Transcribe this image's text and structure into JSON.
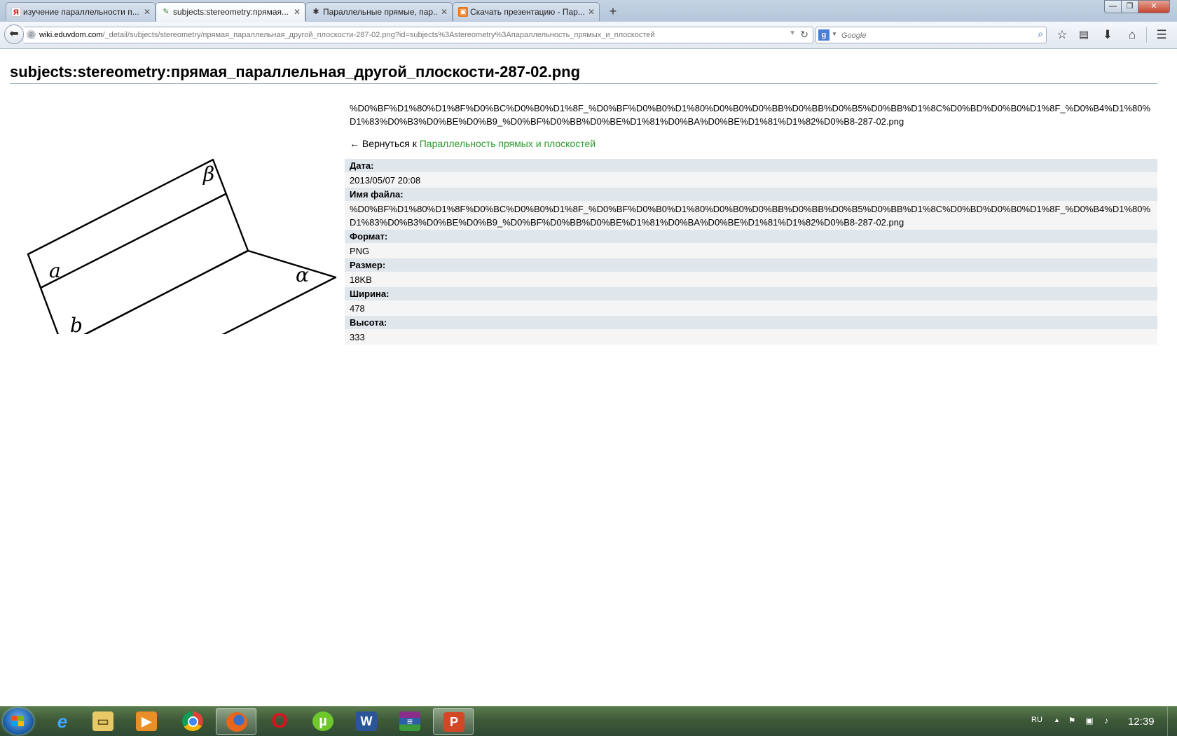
{
  "browser": {
    "tabs": [
      {
        "label": "изучение параллельности п...",
        "icon": "yandex-icon"
      },
      {
        "label": "subjects:stereometry:прямая...",
        "icon": "eduvdom-icon",
        "active": true
      },
      {
        "label": "Параллельные прямые, пар...",
        "icon": "gear-favicon"
      },
      {
        "label": "Скачать презентацию - Пар...",
        "icon": "presentation-icon"
      }
    ],
    "url_host": "wiki.eduvdom.com",
    "url_path": "/_detail/subjects/stereometry/прямая_параллельная_другой_плоскости-287-02.png?id=subjects%3Astereometry%3Aпараллельность_прямых_и_плоскостей",
    "search_placeholder": "Google"
  },
  "page": {
    "title": "subjects:stereometry:прямая_параллельная_другой_плоскости-287-02.png",
    "encoded_filename": "%D0%BF%D1%80%D1%8F%D0%BC%D0%B0%D1%8F_%D0%BF%D0%B0%D1%80%D0%B0%D0%BB%D0%BB%D0%B5%D0%BB%D1%8C%D0%BD%D0%B0%D1%8F_%D0%B4%D1%80%D1%83%D0%B3%D0%BE%D0%B9_%D0%BF%D0%BB%D0%BE%D1%81%D0%BA%D0%BE%D1%81%D1%82%D0%B8-287-02.png",
    "back_prefix": "← Вернуться к ",
    "back_link": "Параллельность прямых и плоскостей",
    "figure_labels": {
      "beta": "β",
      "a": "a",
      "b": "b",
      "alpha": "α"
    },
    "meta": {
      "date_label": "Дата:",
      "date_value": "2013/05/07 20:08",
      "filename_label": "Имя файла:",
      "filename_value": "%D0%BF%D1%80%D1%8F%D0%BC%D0%B0%D1%8F_%D0%BF%D0%B0%D1%80%D0%B0%D0%BB%D0%BB%D0%B5%D0%BB%D1%8C%D0%BD%D0%B0%D1%8F_%D0%B4%D1%80%D1%83%D0%B3%D0%BE%D0%B9_%D0%BF%D0%BB%D0%BE%D1%81%D0%BA%D0%BE%D1%81%D1%82%D0%B8-287-02.png",
      "format_label": "Формат:",
      "format_value": "PNG",
      "size_label": "Размер:",
      "size_value": "18KB",
      "width_label": "Ширина:",
      "width_value": "478",
      "height_label": "Высота:",
      "height_value": "333"
    }
  },
  "taskbar": {
    "apps": [
      "ie-icon",
      "explorer-icon",
      "media-player-icon",
      "chrome-icon",
      "firefox-icon",
      "opera-icon",
      "utorrent-icon",
      "word-icon",
      "winrar-icon",
      "powerpoint-icon"
    ],
    "language": "RU",
    "clock": "12:39"
  }
}
